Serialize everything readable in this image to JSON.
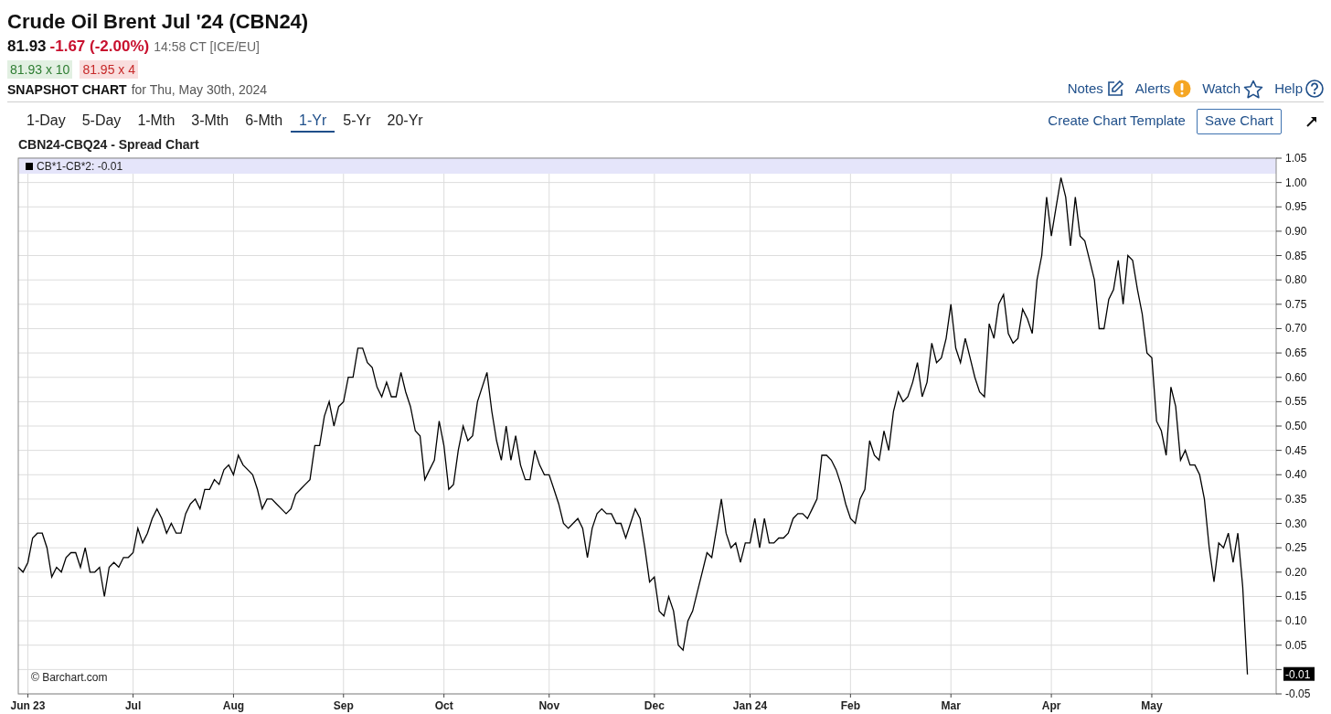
{
  "header": {
    "title": "Crude Oil Brent Jul '24 (CBN24)",
    "price": "81.93",
    "change": "-1.67 (-2.00%)",
    "time": "14:58 CT [ICE/EU]",
    "bid": "81.93 x 10",
    "ask": "81.95 x 4",
    "snapshot_label": "SNAPSHOT CHART",
    "snapshot_date": "for Thu, May 30th, 2024"
  },
  "links": [
    {
      "label": "Notes",
      "kind": "notes"
    },
    {
      "label": "Alerts",
      "kind": "alerts"
    },
    {
      "label": "Watch",
      "kind": "watch"
    },
    {
      "label": "Help",
      "kind": "help"
    }
  ],
  "range_tabs": [
    {
      "label": "1-Day",
      "selected": false
    },
    {
      "label": "5-Day",
      "selected": false
    },
    {
      "label": "1-Mth",
      "selected": false
    },
    {
      "label": "3-Mth",
      "selected": false
    },
    {
      "label": "6-Mth",
      "selected": false
    },
    {
      "label": "1-Yr",
      "selected": true
    },
    {
      "label": "5-Yr",
      "selected": false
    },
    {
      "label": "20-Yr",
      "selected": false
    }
  ],
  "template_link": "Create Chart Template",
  "save_button": "Save Chart",
  "chart": {
    "title": "CBN24-CBQ24 - Spread Chart",
    "legend_value": ": -0.01",
    "month_labels": [
      "Jun 23",
      "Jul",
      "Aug",
      "Sep",
      "Oct",
      "Nov",
      "Dec",
      "Jan 24",
      "Feb",
      "Mar",
      "Apr",
      "May"
    ],
    "last_value": "-0.01",
    "credit": "© Barchart.com",
    "chart_data": {
      "type": "line",
      "grid": true,
      "ylim": [
        -0.05,
        1.05
      ],
      "yticks": [
        {
          "value": -0.05,
          "label": "-0.05"
        },
        {
          "value": 0.05,
          "label": "0.05"
        },
        {
          "value": 0.1,
          "label": "0.10"
        },
        {
          "value": 0.15,
          "label": "0.15"
        },
        {
          "value": 0.2,
          "label": "0.20"
        },
        {
          "value": 0.25,
          "label": "0.25"
        },
        {
          "value": 0.3,
          "label": "0.30"
        },
        {
          "value": 0.35,
          "label": "0.35"
        },
        {
          "value": 0.4,
          "label": "0.40"
        },
        {
          "value": 0.45,
          "label": "0.45"
        },
        {
          "value": 0.5,
          "label": "0.50"
        },
        {
          "value": 0.55,
          "label": "0.55"
        },
        {
          "value": 0.6,
          "label": "0.60"
        },
        {
          "value": 0.65,
          "label": "0.65"
        },
        {
          "value": 0.7,
          "label": "0.70"
        },
        {
          "value": 0.75,
          "label": "0.75"
        },
        {
          "value": 0.8,
          "label": "0.80"
        },
        {
          "value": 0.85,
          "label": "0.85"
        },
        {
          "value": 0.9,
          "label": "0.90"
        },
        {
          "value": 0.95,
          "label": "0.95"
        },
        {
          "value": 1.0,
          "label": "1.00"
        },
        {
          "value": 1.05,
          "label": "1.05"
        }
      ],
      "series": [
        {
          "name": "CB*1-CB*2",
          "color": "#000000",
          "values": [
            0.21,
            0.2,
            0.22,
            0.27,
            0.28,
            0.28,
            0.25,
            0.19,
            0.21,
            0.2,
            0.23,
            0.24,
            0.24,
            0.21,
            0.25,
            0.2,
            0.2,
            0.21,
            0.15,
            0.21,
            0.22,
            0.21,
            0.23,
            0.23,
            0.24,
            0.29,
            0.26,
            0.28,
            0.31,
            0.33,
            0.31,
            0.28,
            0.3,
            0.28,
            0.28,
            0.32,
            0.34,
            0.35,
            0.33,
            0.37,
            0.37,
            0.39,
            0.38,
            0.41,
            0.42,
            0.4,
            0.44,
            0.42,
            0.41,
            0.4,
            0.37,
            0.33,
            0.35,
            0.35,
            0.34,
            0.33,
            0.32,
            0.33,
            0.36,
            0.37,
            0.38,
            0.39,
            0.46,
            0.46,
            0.52,
            0.55,
            0.5,
            0.54,
            0.55,
            0.6,
            0.6,
            0.66,
            0.66,
            0.63,
            0.62,
            0.58,
            0.56,
            0.59,
            0.56,
            0.56,
            0.61,
            0.57,
            0.54,
            0.49,
            0.48,
            0.39,
            0.41,
            0.43,
            0.51,
            0.46,
            0.37,
            0.38,
            0.45,
            0.5,
            0.47,
            0.48,
            0.55,
            0.58,
            0.61,
            0.53,
            0.47,
            0.43,
            0.5,
            0.43,
            0.48,
            0.42,
            0.39,
            0.39,
            0.45,
            0.42,
            0.4,
            0.4,
            0.37,
            0.34,
            0.3,
            0.29,
            0.3,
            0.31,
            0.29,
            0.23,
            0.29,
            0.32,
            0.33,
            0.32,
            0.32,
            0.3,
            0.3,
            0.27,
            0.3,
            0.33,
            0.31,
            0.25,
            0.18,
            0.19,
            0.12,
            0.11,
            0.15,
            0.12,
            0.05,
            0.04,
            0.1,
            0.12,
            0.16,
            0.2,
            0.24,
            0.23,
            0.29,
            0.35,
            0.28,
            0.25,
            0.26,
            0.22,
            0.26,
            0.26,
            0.31,
            0.25,
            0.31,
            0.26,
            0.26,
            0.27,
            0.27,
            0.28,
            0.31,
            0.32,
            0.32,
            0.31,
            0.33,
            0.35,
            0.44,
            0.44,
            0.43,
            0.41,
            0.38,
            0.34,
            0.31,
            0.3,
            0.35,
            0.37,
            0.47,
            0.44,
            0.43,
            0.49,
            0.45,
            0.53,
            0.57,
            0.55,
            0.56,
            0.59,
            0.63,
            0.56,
            0.59,
            0.67,
            0.63,
            0.64,
            0.68,
            0.75,
            0.66,
            0.63,
            0.68,
            0.64,
            0.6,
            0.57,
            0.56,
            0.71,
            0.68,
            0.75,
            0.77,
            0.69,
            0.67,
            0.68,
            0.74,
            0.72,
            0.69,
            0.8,
            0.85,
            0.97,
            0.89,
            0.95,
            1.01,
            0.97,
            0.87,
            0.97,
            0.89,
            0.88,
            0.84,
            0.8,
            0.7,
            0.7,
            0.76,
            0.78,
            0.84,
            0.75,
            0.85,
            0.84,
            0.78,
            0.73,
            0.65,
            0.64,
            0.51,
            0.49,
            0.44,
            0.58,
            0.54,
            0.43,
            0.45,
            0.42,
            0.42,
            0.4,
            0.35,
            0.25,
            0.18,
            0.26,
            0.25,
            0.28,
            0.22,
            0.28,
            0.17,
            -0.01
          ]
        }
      ]
    }
  }
}
